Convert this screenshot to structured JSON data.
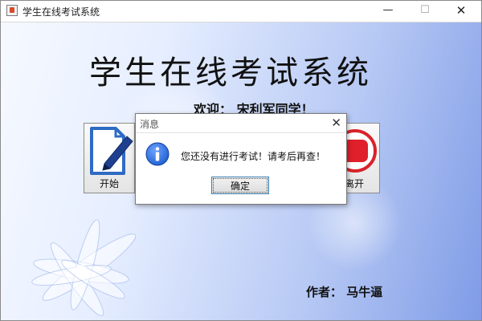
{
  "window": {
    "title": "学生在线考试系统",
    "controls": {
      "minimize": "—",
      "maximize": "☐",
      "close": "✕"
    }
  },
  "main": {
    "title": "学生在线考试系统",
    "welcome": "欢迎： 宋利军同学！",
    "author": "作者： 马牛逼",
    "start_button": {
      "label": "开始",
      "icon": "document-pencil-icon"
    },
    "leave_button": {
      "label": "离开",
      "icon": "exit-icon"
    }
  },
  "dialog": {
    "title": "消息",
    "close": "✕",
    "icon": "info-icon",
    "message": "您还没有进行考试！请考后再查！",
    "ok_label": "确定"
  },
  "colors": {
    "background_start": "#f6f9ff",
    "background_end": "#7f9ce6",
    "info_blue": "#1d5fd1",
    "exit_red": "#e0202a",
    "dialog_button_border": "#3c7fb1"
  }
}
